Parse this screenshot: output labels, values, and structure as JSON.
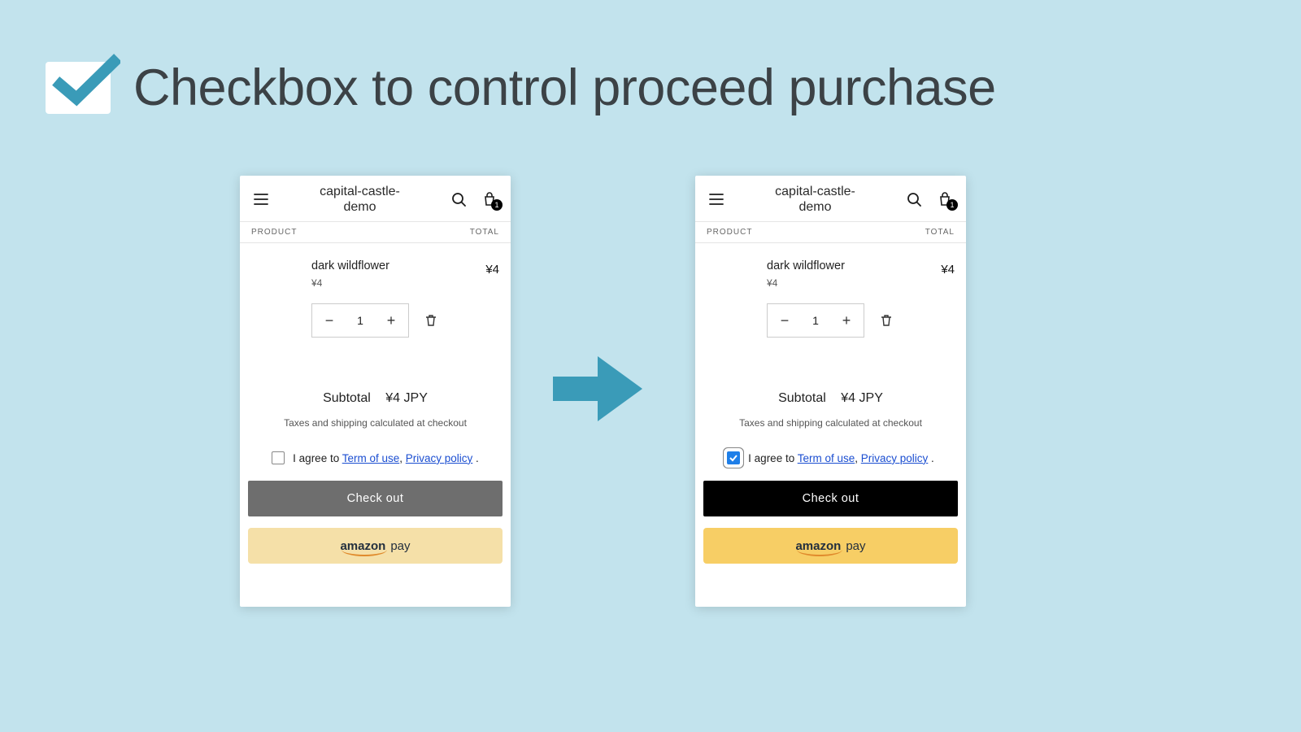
{
  "header": {
    "title": "Checkbox to control proceed purchase"
  },
  "store": {
    "brand": "capital-castle-demo",
    "cart_count": "1",
    "columns": {
      "product": "PRODUCT",
      "total": "TOTAL"
    }
  },
  "product": {
    "name": "dark wildflower",
    "unit_price": "¥4",
    "quantity": "1",
    "line_total": "¥4"
  },
  "summary": {
    "subtotal_label": "Subtotal",
    "subtotal_value": "¥4 JPY",
    "tax_note": "Taxes and shipping calculated at checkout"
  },
  "agree": {
    "prefix": "I agree to ",
    "term_link": "Term of use",
    "sep": ", ",
    "privacy_link": "Privacy policy",
    "suffix": " ."
  },
  "buttons": {
    "checkout": "Check out",
    "amazon_word": "amazon",
    "amazon_pay": "pay"
  }
}
